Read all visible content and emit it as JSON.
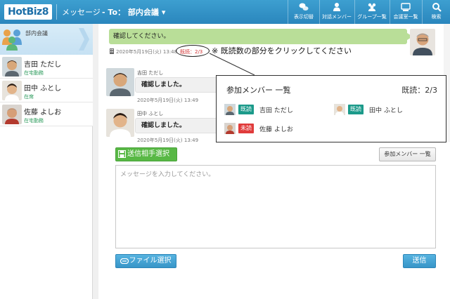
{
  "header": {
    "logo": "HotBiz8",
    "app_label": "メッセージ",
    "to_label": "- To： 部内会議",
    "toolbar": [
      {
        "label": "表示切替",
        "icon": "chat-bubbles-icon"
      },
      {
        "label": "対話メンバー",
        "icon": "person-icon"
      },
      {
        "label": "グループ一覧",
        "icon": "group-icon"
      },
      {
        "label": "会議室一覧",
        "icon": "meeting-room-icon"
      },
      {
        "label": "検索",
        "icon": "search-icon"
      }
    ]
  },
  "sidebar": {
    "group": {
      "label": "部内会議"
    },
    "members": [
      {
        "name": "吉田 ただし",
        "status": "在宅勤務"
      },
      {
        "name": "田中 ふとし",
        "status": "在席"
      },
      {
        "name": "佐藤 よしお",
        "status": "在宅勤務"
      }
    ]
  },
  "messages": {
    "mine": {
      "text": "確認してください。",
      "timestamp": "2020年5月19日(火) 13:48",
      "read_status": "既読：2/3"
    },
    "annotation": "※ 既読数の部分をクリックしてください",
    "others": [
      {
        "sender": "吉田 ただし",
        "text": "確認しました。",
        "timestamp": "2020年5月19日(火) 13:49"
      },
      {
        "sender": "田中 ふとし",
        "text": "確認しました。",
        "timestamp": "2020年5月19日(火) 13:49"
      }
    ]
  },
  "popup": {
    "title": "参加メンバー 一覧",
    "count": "既読：2/3",
    "members": [
      {
        "badge": "既読",
        "name": "吉田 ただし",
        "state": "read"
      },
      {
        "badge": "既読",
        "name": "田中 ふとし",
        "state": "read"
      },
      {
        "badge": "未読",
        "name": "佐藤 よしお",
        "state": "unread"
      }
    ]
  },
  "compose": {
    "recipient_button": "送信相手選択",
    "members_button": "参加メンバー 一覧",
    "placeholder": "メッセージを入力してください。",
    "file_button": "ファイル選択",
    "send_button": "送信"
  },
  "colors": {
    "header": "#2a86bd",
    "mine_bubble": "#b9de98",
    "read_badge": "#1b9a8a",
    "unread_badge": "#e03b3b",
    "green_button": "#58b845",
    "blue_button": "#3795c8"
  }
}
